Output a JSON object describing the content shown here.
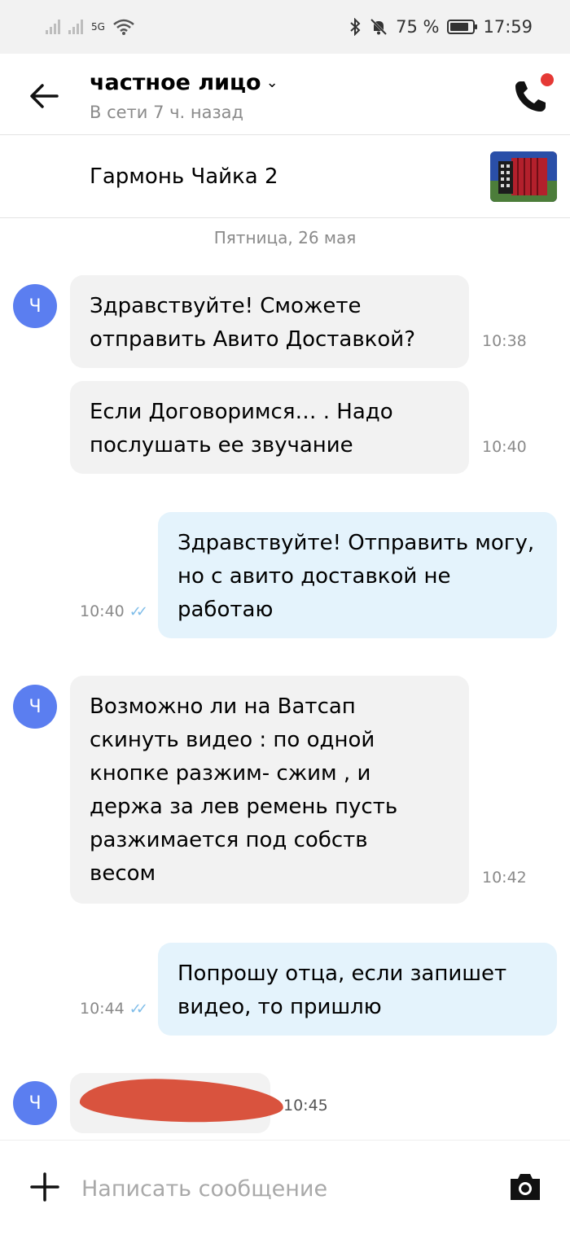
{
  "status_bar": {
    "signal": "5G",
    "battery": "75 %",
    "time": "17:59"
  },
  "header": {
    "contact_name": "частное лицо",
    "contact_status": "В сети 7 ч. назад"
  },
  "listing": {
    "title": "Гармонь Чайка 2"
  },
  "chat": {
    "date_separator": "Пятница, 26 мая",
    "avatar_letter": "Ч",
    "messages": [
      {
        "direction": "in",
        "text": "Здравствуйте! Сможете отправить Авито Доставкой?",
        "time": "10:38"
      },
      {
        "direction": "in",
        "text": "Если Договоримся… . Надо послушать ее звучание",
        "time": "10:40"
      },
      {
        "direction": "out",
        "text": "Здравствуйте! Отправить могу, но с авито доставкой не работаю",
        "time": "10:40",
        "status": "read"
      },
      {
        "direction": "in",
        "text": "Возможно ли на Ватсап скинуть видео : по одной кнопке разжим- сжим , и держа за лев ремень пусть разжимается под собств весом",
        "time": "10:42"
      },
      {
        "direction": "out",
        "text": "Попрошу отца, если запишет видео, то пришлю",
        "time": "10:44",
        "status": "read"
      },
      {
        "direction": "in",
        "text": "",
        "time": "10:45",
        "redacted": true
      }
    ]
  },
  "composer": {
    "placeholder": "Написать сообщение"
  },
  "icons": {
    "back": "arrow-left-icon",
    "dropdown": "chevron-down-icon",
    "call": "phone-icon",
    "attach": "plus-icon",
    "camera": "camera-icon"
  },
  "colors": {
    "incoming_bubble": "#f2f2f2",
    "outgoing_bubble": "#e4f3fc",
    "avatar": "#5b7ef0",
    "read_ticks": "#7fbde9",
    "notification_dot": "#e53935"
  }
}
